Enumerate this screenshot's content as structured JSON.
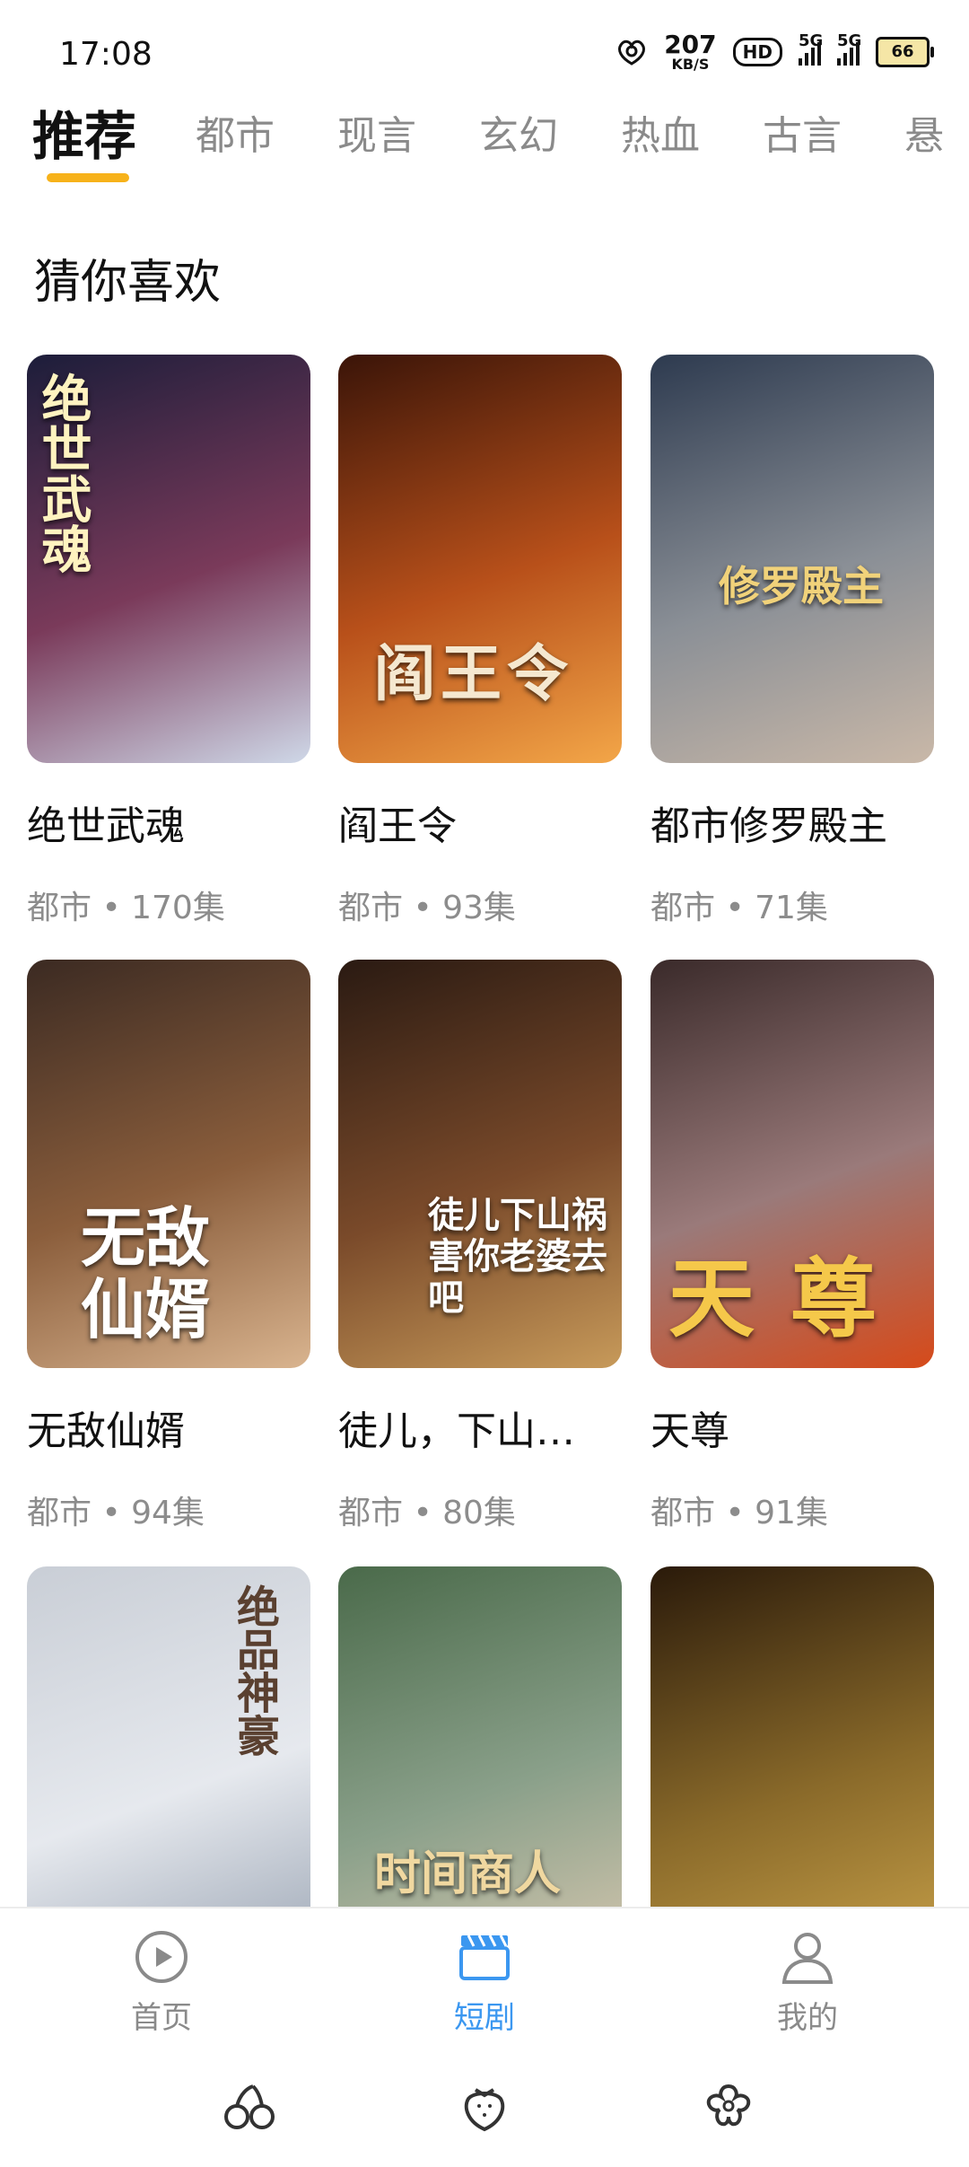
{
  "status_bar": {
    "time": "17:08",
    "speed_value": "207",
    "speed_unit": "KB/S",
    "hd_label": "HD",
    "network_1": "5G",
    "network_2": "5G",
    "battery": "66"
  },
  "tabs": [
    "推荐",
    "都市",
    "现言",
    "玄幻",
    "热血",
    "古言",
    "悬"
  ],
  "section_title": "猜你喜欢",
  "cards": [
    {
      "title": "绝世武魂",
      "meta": "都市 • 170集",
      "poster_text": "绝世武魂",
      "colors": [
        "#1c1d3a",
        "#7a3a5a",
        "#cfd8e8"
      ]
    },
    {
      "title": "阎王令",
      "meta": "都市 • 93集",
      "poster_text": "阎王令",
      "colors": [
        "#3a1408",
        "#b8501a",
        "#f3a648"
      ]
    },
    {
      "title": "都市修罗殿主",
      "meta": "都市 • 71集",
      "poster_text": "修罗殿主",
      "colors": [
        "#2d3a4f",
        "#8a8f96",
        "#c9b8a8"
      ]
    },
    {
      "title": "无敌仙婿",
      "meta": "都市 • 94集",
      "poster_text": "无敌仙婿",
      "colors": [
        "#3b2a22",
        "#8b5e3c",
        "#d9b48f"
      ]
    },
    {
      "title": "徒儿，下山…",
      "meta": "都市 • 80集",
      "poster_text": "徒儿下山祸害你老婆去吧",
      "colors": [
        "#2a1a12",
        "#7a4a2a",
        "#c79a5a"
      ]
    },
    {
      "title": "天尊",
      "meta": "都市 • 91集",
      "poster_text": "天尊",
      "colors": [
        "#3a2a2a",
        "#9a7a7a",
        "#d64a1a"
      ]
    },
    {
      "title": "",
      "meta": "",
      "poster_text": "绝品神豪",
      "colors": [
        "#c9ced6",
        "#e6e9ee",
        "#9aa4b3"
      ]
    },
    {
      "title": "",
      "meta": "",
      "poster_text": "时间商人",
      "colors": [
        "#4a6a4a",
        "#8aa08a",
        "#d8c8b0"
      ]
    },
    {
      "title": "",
      "meta": "",
      "poster_text": "",
      "colors": [
        "#2a1a0a",
        "#8a6a2a",
        "#c9a24a"
      ]
    }
  ],
  "bottom_nav": [
    {
      "label": "首页",
      "icon": "play-circle-icon"
    },
    {
      "label": "短剧",
      "icon": "clapperboard-icon"
    },
    {
      "label": "我的",
      "icon": "person-icon"
    }
  ],
  "system_bar": [
    {
      "icon": "cherry-icon"
    },
    {
      "icon": "strawberry-icon"
    },
    {
      "icon": "flower-icon"
    }
  ],
  "colors": {
    "accent_underline": "#f7b21a",
    "nav_active": "#3b97f0",
    "inactive_text": "#8a8a8a"
  }
}
